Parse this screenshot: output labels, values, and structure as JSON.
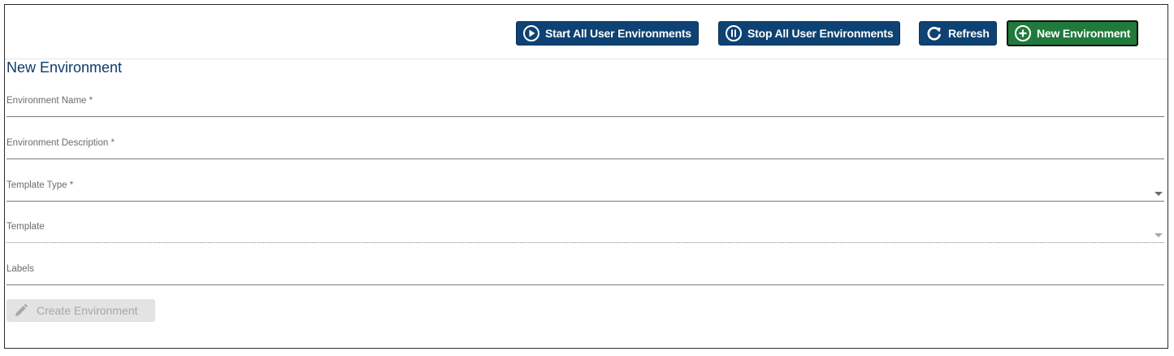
{
  "toolbar": {
    "start_all_label": "Start All User Environments",
    "stop_all_label": "Stop All User Environments",
    "refresh_label": "Refresh",
    "new_env_label": "New Environment",
    "icons": {
      "start": "play-circle-icon",
      "stop": "pause-circle-icon",
      "refresh": "refresh-icon",
      "new": "plus-circle-icon"
    },
    "colors": {
      "primary": "#0d4273",
      "success": "#1f7a3c"
    }
  },
  "form": {
    "title": "New Environment",
    "fields": [
      {
        "label": "Environment Name *",
        "value": ""
      },
      {
        "label": "Environment Description *",
        "value": ""
      },
      {
        "label": "Template Type *",
        "value": ""
      },
      {
        "label": "Template",
        "value": ""
      },
      {
        "label": "Labels",
        "value": ""
      }
    ],
    "submit_label": "Create Environment",
    "submit_icon": "pencil-icon"
  }
}
